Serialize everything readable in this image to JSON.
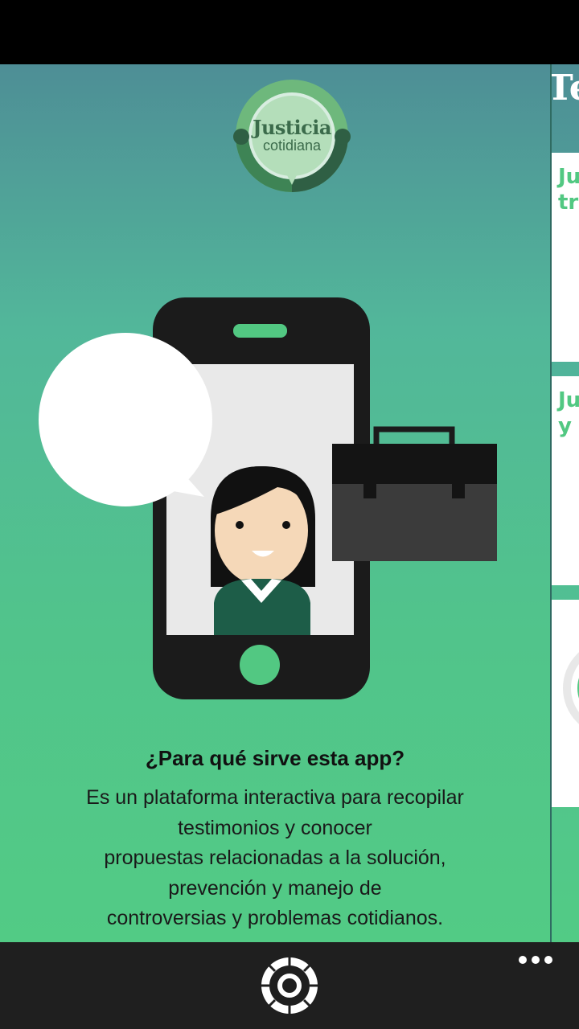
{
  "logo": {
    "title": "Justicia",
    "subtitle": "cotidiana"
  },
  "main": {
    "heading": "¿Para qué sirve esta app?",
    "description_lines": [
      "Es un plataforma interactiva para recopilar",
      "testimonios y conocer",
      "propuestas relacionadas a la solución,",
      "prevención y manejo de",
      "controversias y problemas cotidianos."
    ]
  },
  "next_panel": {
    "title_fragment": "Te",
    "cards": [
      {
        "text": "Ju\ntr"
      },
      {
        "text": "Ju\ny"
      }
    ]
  },
  "app_bar": {
    "icons": [
      "lifebuoy-icon",
      "more-icon"
    ]
  },
  "colors": {
    "accent_green": "#52c882",
    "phone_body": "#1b1b1b",
    "briefcase": "#3b3b3b",
    "app_bar_bg": "#1f1f1f"
  }
}
